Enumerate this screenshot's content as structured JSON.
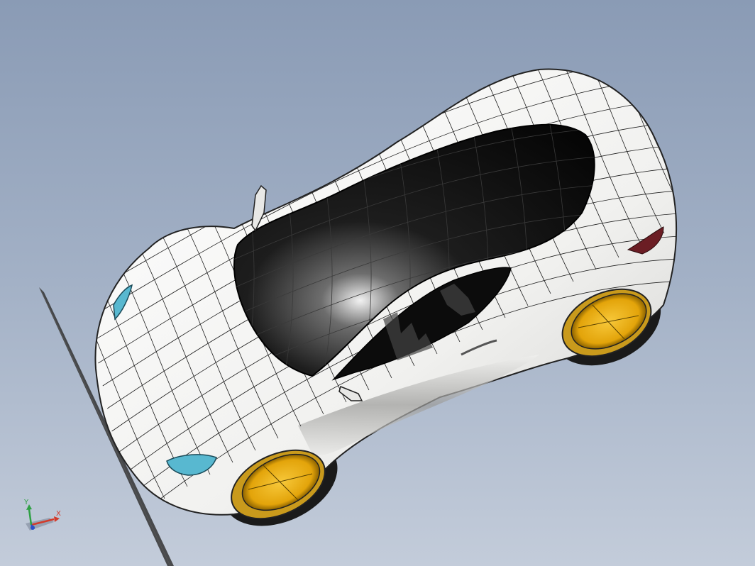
{
  "viewport": {
    "colors": {
      "background_top": "#8a9bb5",
      "background_bottom": "#c3ccda",
      "body_paint": "#f4f4f2",
      "glass": "#111111",
      "rim": "#e6a80c",
      "light_lens": "#58b8d0"
    }
  },
  "triad": {
    "x_label": "X",
    "y_label": "Y",
    "x_color": "#d33a2a",
    "y_color": "#2ea043",
    "z_color": "#2a4fc9"
  }
}
